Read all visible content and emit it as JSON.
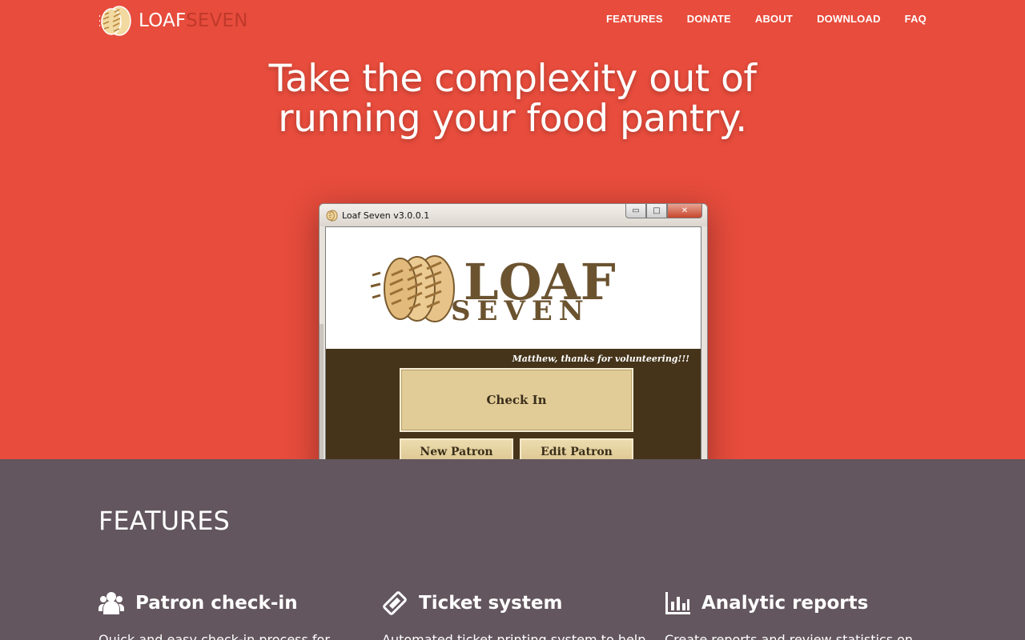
{
  "brand": {
    "loaf": "LOAF",
    "seven": "SEVEN"
  },
  "nav": [
    {
      "label": "FEATURES"
    },
    {
      "label": "DONATE"
    },
    {
      "label": "ABOUT"
    },
    {
      "label": "DOWNLOAD"
    },
    {
      "label": "FAQ"
    }
  ],
  "hero": {
    "line1": "Take the complexity out of",
    "line2": "running your food pantry."
  },
  "app_window": {
    "title": "Loaf Seven v3.0.0.1",
    "logo_word1": "LOAF",
    "logo_word2": "SEVEN",
    "greeting": "Matthew, thanks for volunteering!!!",
    "check_in": "Check In",
    "new_patron": "New Patron",
    "edit_patron": "Edit Patron",
    "controls": {
      "minimize": "▭",
      "maximize": "□",
      "close": "✕"
    }
  },
  "features": {
    "title": "FEATURES",
    "items": [
      {
        "icon": "users-icon",
        "title": "Patron check-in",
        "desc": "Quick and easy check-in process for"
      },
      {
        "icon": "ticket-icon",
        "title": "Ticket system",
        "desc": "Automated ticket printing system to help"
      },
      {
        "icon": "bar-chart-icon",
        "title": "Analytic reports",
        "desc": "Create reports and review statistics on"
      }
    ]
  },
  "colors": {
    "hero_bg": "#e74c3c",
    "brand_seven": "#c0392b",
    "features_bg": "#63565e",
    "app_dark": "#45341a",
    "app_button": "#e1cb97"
  }
}
